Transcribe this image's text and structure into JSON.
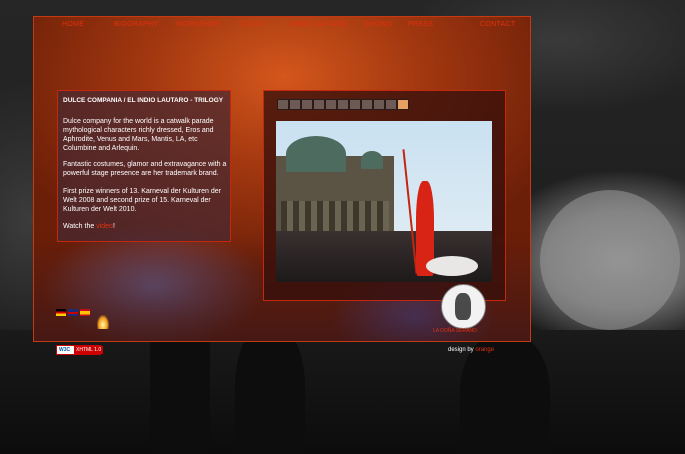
{
  "nav": {
    "items": [
      "HOME",
      "BIOGRAPHY",
      "WORKSHOP",
      "DULCE",
      "INDIO LAUTARO",
      "SHOWS",
      "PRESS",
      "CONTACT"
    ]
  },
  "article": {
    "title": "DULCE COMPANIA / EL INDIO LAUTARO - TRILOGY",
    "p1": "Dulce company for the world is a catwalk parade mythological characters richly dressed, Eros and Aphrodite, Venus and Mars, Mantis, LA, etc Columbine and Arlequin.",
    "p2": "Fantastic costumes, glamor and extravagance with a powerful stage presence are her trademark brand.",
    "p3": "First prize winners of 13. Karneval der Kulturen der Welt 2008 and second prize of 15. Karneval der Kulturen der Welt 2010.",
    "p4_prefix": "Watch the",
    "p4_link": "video",
    "p4_suffix": "!"
  },
  "gallery": {
    "thumb_count": 11,
    "active_thumb": 10
  },
  "logo": {
    "text": "LA DOÑA SERANO"
  },
  "footer": {
    "w3c_a": "W3C",
    "w3c_b": "XHTML 1.0",
    "credit_prefix": "design by",
    "credit_name": "orange"
  },
  "colors": {
    "accent": "#e2300e",
    "frame_border": "#c53a12"
  }
}
